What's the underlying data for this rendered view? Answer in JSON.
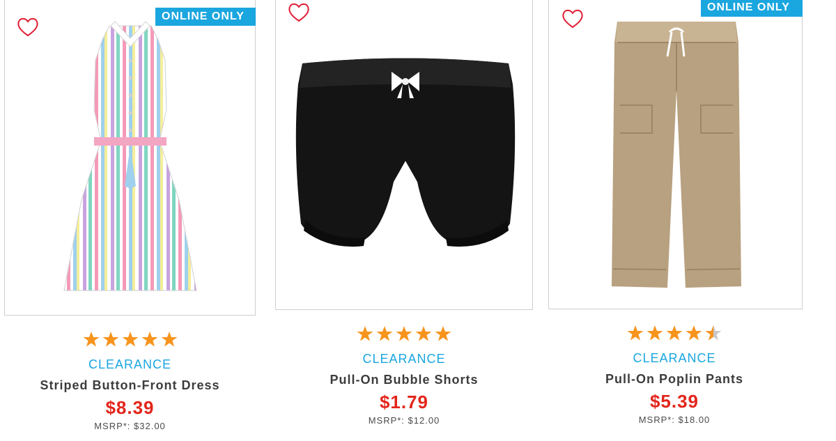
{
  "colors": {
    "accent": "#1aa6df",
    "price": "#e3251b",
    "star": "#f7941d",
    "heart": "#e01e35"
  },
  "products": [
    {
      "badge": "ONLINE ONLY",
      "rating": 5,
      "clearance_label": "CLEARANCE",
      "title": "Striped Button-Front Dress",
      "price": "$8.39",
      "msrp": "MSRP*: $32.00",
      "icon": "heart-outline-icon"
    },
    {
      "badge": "",
      "rating": 5,
      "clearance_label": "CLEARANCE",
      "title": "Pull-On Bubble Shorts",
      "price": "$1.79",
      "msrp": "MSRP*: $12.00",
      "icon": "heart-outline-icon"
    },
    {
      "badge": "ONLINE ONLY",
      "rating": 4.5,
      "clearance_label": "CLEARANCE",
      "title": "Pull-On Poplin Pants",
      "price": "$5.39",
      "msrp": "MSRP*: $18.00",
      "icon": "heart-outline-icon"
    }
  ]
}
